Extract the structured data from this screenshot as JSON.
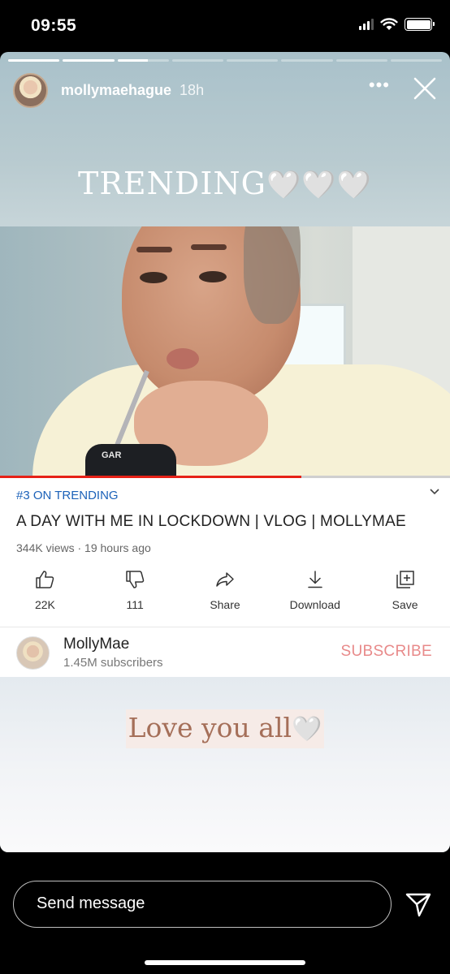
{
  "status_bar": {
    "time": "09:55",
    "icons": [
      "cellular-signal-icon",
      "wifi-icon",
      "battery-icon"
    ]
  },
  "story": {
    "progress": {
      "total_segments": 8,
      "completed_segments": 2,
      "current_segment_fraction": 0.6
    },
    "username": "mollymaehague",
    "posted_ago": "18h",
    "more_icon": "more-dots-icon",
    "close_icon": "close-icon",
    "caption_top": "TRENDING",
    "caption_top_emoji": "🤍🤍🤍",
    "caption_bottom": "Love you all",
    "caption_bottom_emoji": "🤍"
  },
  "video": {
    "can_text": "GAR",
    "played_fraction": 0.67,
    "progress_color": "#e62117"
  },
  "youtube": {
    "badge": "#3 ON TRENDING",
    "title": "A DAY WITH ME IN LOCKDOWN | VLOG | MOLLYMAE",
    "meta": "344K views · 19 hours ago",
    "actions": [
      {
        "icon": "thumbs-up-icon",
        "label": "22K"
      },
      {
        "icon": "thumbs-down-icon",
        "label": "111"
      },
      {
        "icon": "share-arrow-icon",
        "label": "Share"
      },
      {
        "icon": "download-icon",
        "label": "Download"
      },
      {
        "icon": "add-to-playlist-icon",
        "label": "Save"
      }
    ],
    "channel": {
      "name": "MollyMae",
      "subscribers": "1.45M subscribers",
      "subscribe_label": "SUBSCRIBE"
    },
    "badge_color": "#1c62b9",
    "subscribe_color": "#e88a8a"
  },
  "message_bar": {
    "placeholder": "Send message",
    "send_icon": "send-paper-plane-icon"
  }
}
